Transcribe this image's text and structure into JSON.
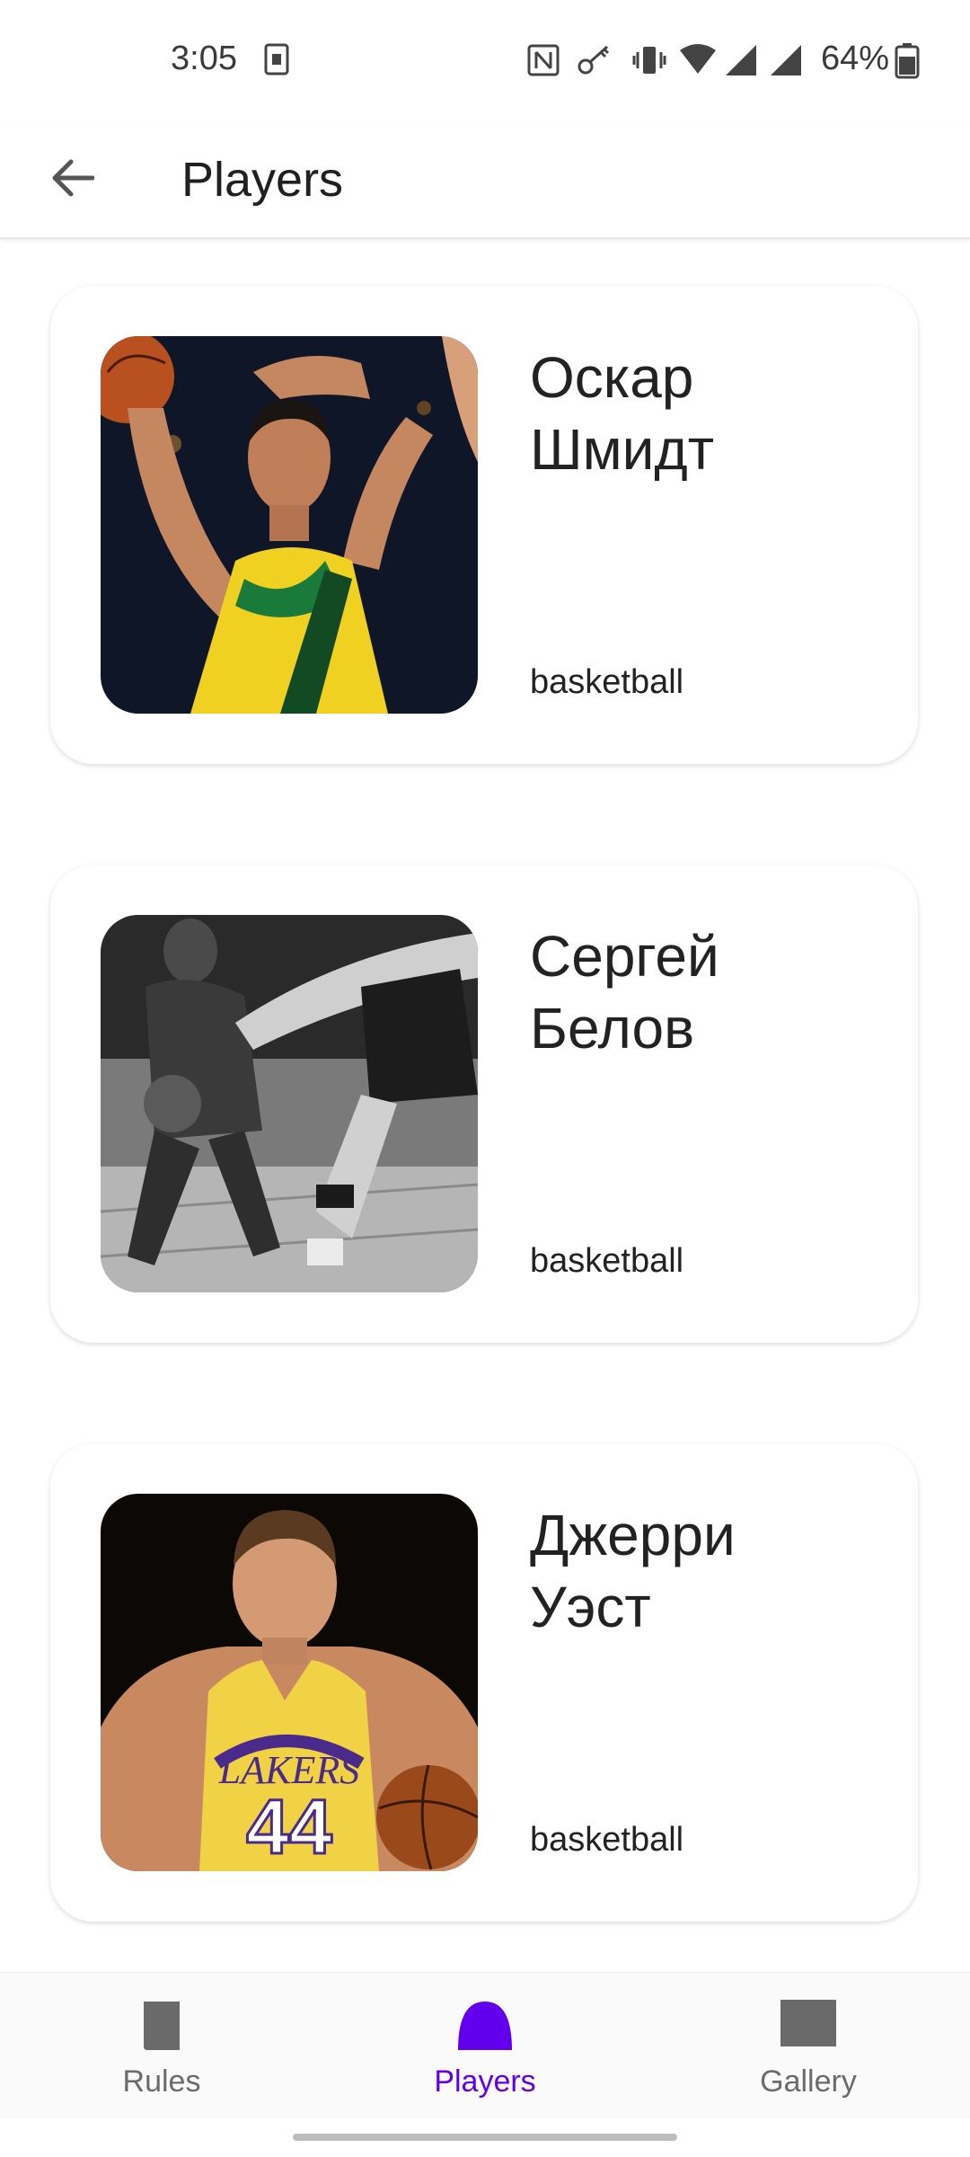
{
  "status_bar": {
    "time": "3:05",
    "battery": "64%",
    "icons": [
      "sim-card-icon",
      "nfc-icon",
      "key-icon",
      "vibrate-icon",
      "wifi-icon",
      "signal-icon",
      "signal-icon",
      "battery-icon"
    ]
  },
  "app_bar": {
    "back_icon": "arrow-back-icon",
    "title": "Players"
  },
  "players": [
    {
      "name": "Оскар\nШмидт",
      "sport": "basketball",
      "photo": "player-photo-oskar"
    },
    {
      "name": "Сергей\nБелов",
      "sport": "basketball",
      "photo": "player-photo-sergey"
    },
    {
      "name": "Джерри\nУэст",
      "sport": "basketball",
      "photo": "player-photo-jerry"
    }
  ],
  "bottom_nav": {
    "items": [
      {
        "label": "Rules",
        "icon": "book-icon",
        "active": false
      },
      {
        "label": "Players",
        "icon": "player-icon",
        "active": true
      },
      {
        "label": "Gallery",
        "icon": "gallery-icon",
        "active": false
      }
    ],
    "active_color": "#6200EE",
    "inactive_color": "#6b6b6b"
  }
}
